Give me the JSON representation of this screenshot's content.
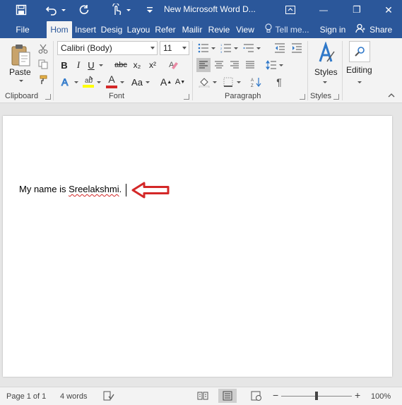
{
  "window": {
    "title": "New Microsoft Word D...",
    "minimize_glyph": "—",
    "restore_glyph": "❐",
    "close_glyph": "✕"
  },
  "quick_access": {
    "save_icon": "save-icon",
    "undo_icon": "undo-icon",
    "redo_icon": "redo-icon",
    "touch_icon": "touch-mode-icon",
    "customize_icon": "customize-icon"
  },
  "tabs": {
    "file": "File",
    "items": [
      "Hom",
      "Insert",
      "Desig",
      "Layou",
      "Refer",
      "Mailir",
      "Revie",
      "View"
    ],
    "tell_me": "Tell me...",
    "sign_in": "Sign in",
    "share": "Share"
  },
  "ribbon": {
    "clipboard": {
      "label": "Clipboard",
      "paste": "Paste"
    },
    "font": {
      "label": "Font",
      "font_name": "Calibri (Body)",
      "font_size": "11",
      "bold": "B",
      "italic": "I",
      "underline": "U",
      "strikethrough": "abc",
      "subscript": "x₂",
      "superscript": "x²",
      "font_color": "A",
      "change_case": "Aa",
      "grow": "A",
      "shrink": "A",
      "highlight_color": "#ffff00",
      "font_color_value": "#d42828"
    },
    "paragraph": {
      "label": "Paragraph",
      "pilcrow": "¶"
    },
    "styles": {
      "label": "Styles",
      "button": "Styles"
    },
    "editing": {
      "button": "Editing"
    }
  },
  "document": {
    "text_before": "My name is ",
    "misspelled": "Sreelakshmi",
    "text_after": ".",
    "annotation_arrow_color": "#d42828"
  },
  "status_bar": {
    "page": "Page 1 of 1",
    "words": "4 words",
    "zoom_minus": "−",
    "zoom_plus": "+",
    "zoom": "100%"
  },
  "colors": {
    "accent": "#2b579a",
    "ribbon_bg": "#f3f3f3",
    "doc_bg": "#e6e6e6"
  }
}
